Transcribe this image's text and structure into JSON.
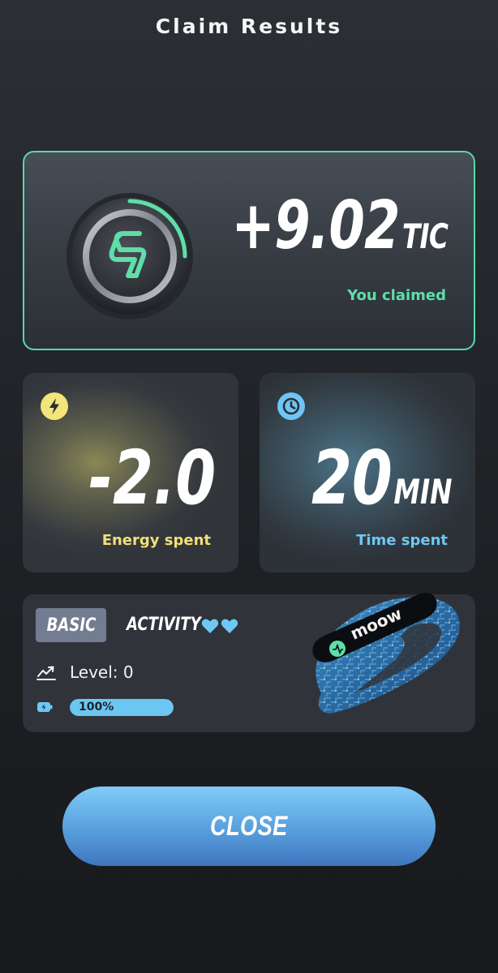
{
  "header": {
    "title": "Claim Results"
  },
  "claim": {
    "amount": "+9.02",
    "unit": "TIC",
    "label": "You claimed",
    "accent": "#5edfa8"
  },
  "stats": {
    "energy": {
      "value": "-2.0",
      "label": "Energy spent",
      "icon": "lightning-icon",
      "color": "#f2df7a"
    },
    "time": {
      "value": "20",
      "unit": "MIN",
      "label": "Time spent",
      "icon": "clock-icon",
      "color": "#6ec8f5"
    }
  },
  "device": {
    "tier": "BASIC",
    "type": "ACTIVITY",
    "hearts": 2,
    "level_text": "Level: 0",
    "battery_text": "100%",
    "battery_fraction": 1.0,
    "band_brand": "moow"
  },
  "close_button": {
    "label": "CLOSE"
  }
}
